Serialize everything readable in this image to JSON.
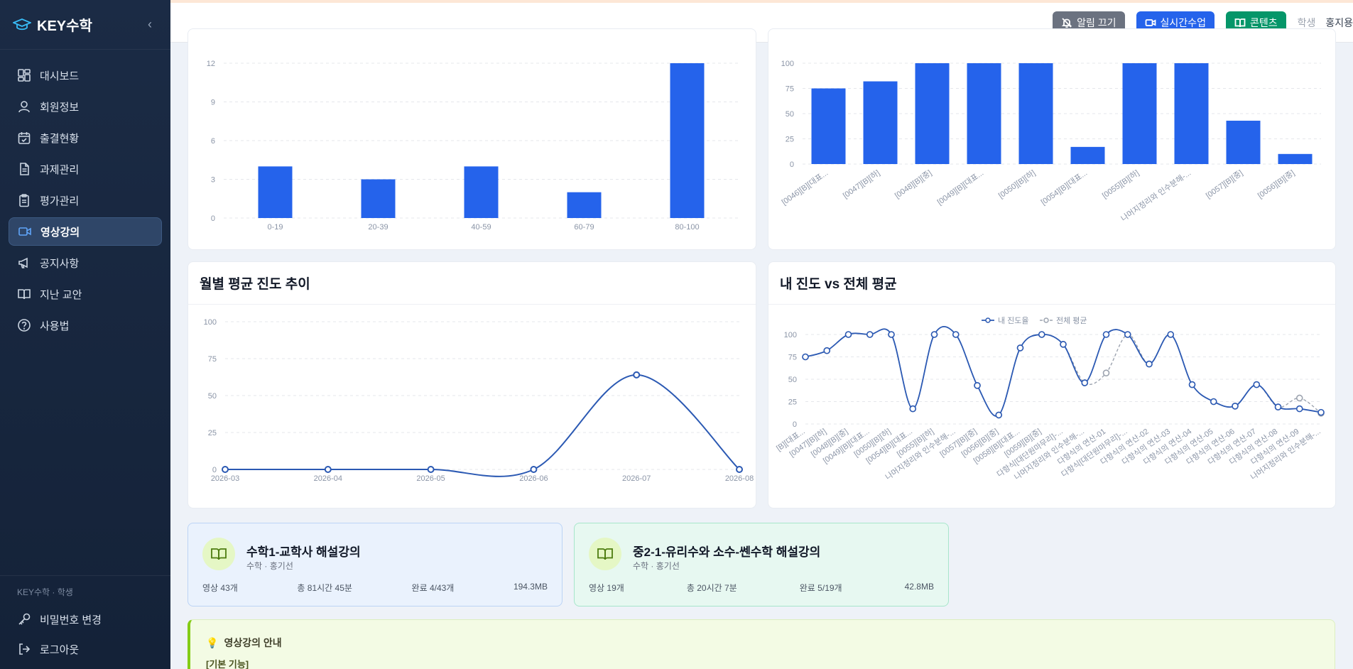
{
  "app": {
    "name": "KEY수학",
    "collapse_icon": "chevron-left-icon"
  },
  "sidebar": {
    "items": [
      {
        "label": "대시보드",
        "icon": "dashboard-icon"
      },
      {
        "label": "회원정보",
        "icon": "user-icon"
      },
      {
        "label": "출결현황",
        "icon": "calendar-check-icon"
      },
      {
        "label": "과제관리",
        "icon": "document-icon"
      },
      {
        "label": "평가관리",
        "icon": "clipboard-icon"
      },
      {
        "label": "영상강의",
        "icon": "video-icon",
        "active": true
      },
      {
        "label": "공지사항",
        "icon": "megaphone-icon"
      },
      {
        "label": "지난 교안",
        "icon": "book-open-icon"
      },
      {
        "label": "사용법",
        "icon": "help-circle-icon"
      }
    ],
    "footer_caption": "KEY수학 · 학생",
    "footer_items": [
      {
        "label": "비밀번호 변경",
        "icon": "key-icon"
      },
      {
        "label": "로그아웃",
        "icon": "logout-icon"
      }
    ]
  },
  "topbar": {
    "alarm_off": "알림 끄기",
    "live_class": "실시간수업",
    "content": "콘텐츠",
    "role": "학생",
    "user": "홍지용"
  },
  "colors": {
    "bar": "#2563eb",
    "line": "#2b59b3",
    "accent_green": "#059669"
  },
  "chart_data": [
    {
      "type": "bar",
      "title": "",
      "categories": [
        "0-19",
        "20-39",
        "40-59",
        "60-79",
        "80-100"
      ],
      "values": [
        4,
        3,
        4,
        2,
        12
      ],
      "yticks": [
        0,
        3,
        6,
        9,
        12
      ],
      "ylim": [
        0,
        12
      ],
      "grid": true
    },
    {
      "type": "bar",
      "title": "",
      "categories": [
        "[0046][B][대표...",
        "[0047][B][하]",
        "[0048][B][중]",
        "[0049][B][대표...",
        "[0050][B][하]",
        "[0054][B][대표...",
        "[0055][B][하]",
        "나머지정리와 인수분해-...",
        "[0057][B][중]",
        "[0056][B][중]"
      ],
      "values": [
        75,
        82,
        100,
        100,
        100,
        17,
        100,
        100,
        43,
        10
      ],
      "yticks": [
        0,
        25,
        50,
        75,
        100
      ],
      "ylim": [
        0,
        100
      ],
      "grid": true
    },
    {
      "type": "line",
      "title": "월별 평균 진도 추이",
      "categories": [
        "2026-03",
        "2026-04",
        "2026-05",
        "2026-06",
        "2026-07",
        "2026-08"
      ],
      "values": [
        0,
        0,
        0,
        0,
        64,
        0
      ],
      "yticks": [
        0,
        25,
        50,
        75,
        100
      ],
      "ylim": [
        0,
        100
      ],
      "grid": true
    },
    {
      "type": "line",
      "title": "내 진도 vs 전체 평균",
      "legend_position": "top-center",
      "categories": [
        "[B][대표...",
        "[0047][B][하]",
        "[0048][B][중]",
        "[0049][B][대표...",
        "[0050][B][하]",
        "[0054][B][대표...",
        "[0055][B][하]",
        "나머지정리와 인수분해-...",
        "[0057][B][중]",
        "[0056][B][중]",
        "[0058][B][대표...",
        "[0059][B][중]",
        "다항식[대단원마무리]-...",
        "나머지정리와 인수분해-...",
        "다항식의 연산-01",
        "다항식[대단원마무리]-...",
        "다항식의 연산-02",
        "다항식의 연산-03",
        "다항식의 연산-04",
        "다항식의 연산-05",
        "다항식의 연산-06",
        "다항식의 연산-07",
        "다항식의 연산-08",
        "다항식의 연산-09",
        "나머지정리와 인수분해-..."
      ],
      "series": [
        {
          "name": "내 진도율",
          "values": [
            75,
            82,
            100,
            100,
            100,
            17,
            100,
            100,
            43,
            10,
            85,
            100,
            89,
            46,
            100,
            100,
            67,
            100,
            44,
            25,
            20,
            44,
            19,
            17,
            13
          ]
        },
        {
          "name": "전체 평균",
          "values": [
            75,
            82,
            100,
            100,
            100,
            17,
            100,
            100,
            43,
            10,
            85,
            100,
            89,
            46,
            57,
            100,
            67,
            100,
            44,
            25,
            20,
            44,
            19,
            29,
            12
          ]
        }
      ],
      "yticks": [
        0,
        25,
        50,
        75,
        100
      ],
      "ylim": [
        0,
        100
      ],
      "grid": true
    }
  ],
  "courses": [
    {
      "title": "수학1-교학사 해설강의",
      "subtitle": "수학 · 홍기선",
      "videos": "영상 43개",
      "total": "총 81시간 45분",
      "done": "완료 4/43개",
      "size": "194.3MB"
    },
    {
      "title": "중2-1-유리수와 소수-쎈수학 해설강의",
      "subtitle": "수학 · 홍기선",
      "videos": "영상 19개",
      "total": "총 20시간 7분",
      "done": "완료 5/19개",
      "size": "42.8MB"
    }
  ],
  "info": {
    "title": "영상강의 안내",
    "subtitle": "[기본 기능]"
  }
}
